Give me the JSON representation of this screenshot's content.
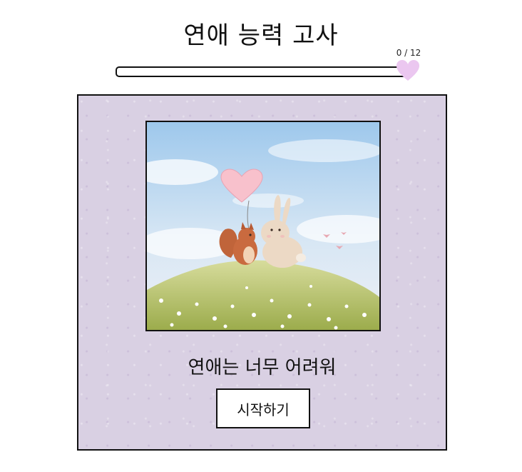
{
  "header": {
    "title": "연애 능력 고사"
  },
  "progress": {
    "label": "0 / 12",
    "current": 0,
    "total": 12,
    "fill_fraction": 0,
    "marker_icon": "heart-icon",
    "marker_color": "#ebc7f0"
  },
  "card": {
    "background_color": "#d9d0e3",
    "illustration": "squirrel-and-rabbit-with-heart-balloon-illustration",
    "subtitle": "연애는 너무 어려워",
    "start_button_label": "시작하기"
  }
}
